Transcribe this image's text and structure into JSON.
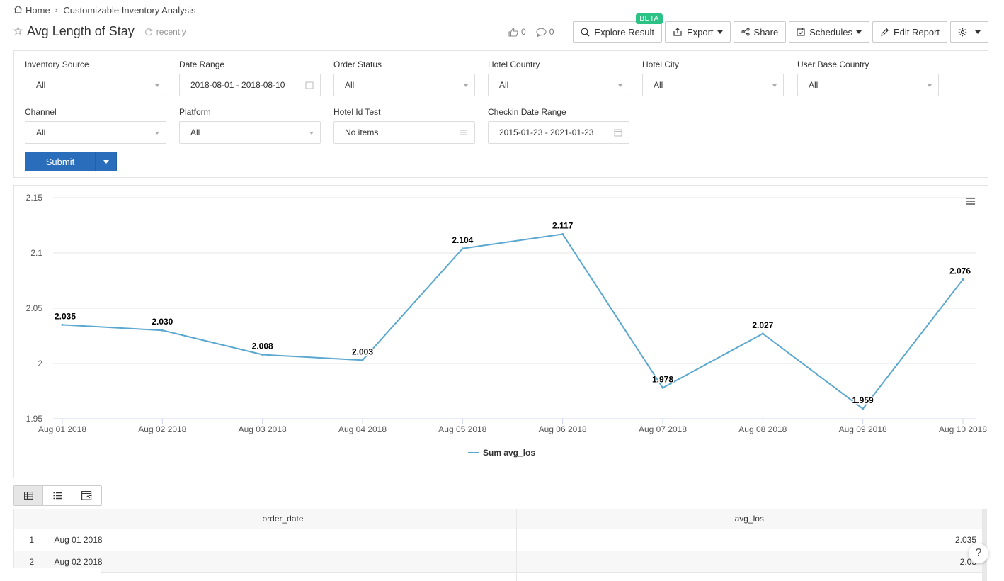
{
  "breadcrumb": {
    "home": "Home",
    "current": "Customizable Inventory Analysis"
  },
  "title": "Avg Length of Stay",
  "refresh_text": "recently",
  "likes": "0",
  "comments": "0",
  "actions": {
    "explore": "Explore Result",
    "beta": "BETA",
    "export": "Export",
    "share": "Share",
    "schedules": "Schedules",
    "edit": "Edit Report"
  },
  "filters": [
    {
      "label": "Inventory Source",
      "value": "All",
      "kind": "select"
    },
    {
      "label": "Date Range",
      "value": "2018-08-01 - 2018-08-10",
      "kind": "date"
    },
    {
      "label": "Order Status",
      "value": "All",
      "kind": "select"
    },
    {
      "label": "Hotel Country",
      "value": "All",
      "kind": "select"
    },
    {
      "label": "Hotel City",
      "value": "All",
      "kind": "select"
    },
    {
      "label": "User Base Country",
      "value": "All",
      "kind": "select"
    },
    {
      "label": "Channel",
      "value": "All",
      "kind": "select"
    },
    {
      "label": "Platform",
      "value": "All",
      "kind": "select"
    },
    {
      "label": "Hotel Id Test",
      "value": "No items",
      "kind": "list"
    },
    {
      "label": "Checkin Date Range",
      "value": "2015-01-23 - 2021-01-23",
      "kind": "date"
    }
  ],
  "submit_label": "Submit",
  "colors": {
    "line": "#5aa7cf",
    "primary": "#2a6ebb",
    "beta": "#2cc185"
  },
  "chart_data": {
    "type": "line",
    "categories": [
      "Aug 01 2018",
      "Aug 02 2018",
      "Aug 03 2018",
      "Aug 04 2018",
      "Aug 05 2018",
      "Aug 06 2018",
      "Aug 07 2018",
      "Aug 08 2018",
      "Aug 09 2018",
      "Aug 10 2018"
    ],
    "series": [
      {
        "name": "Sum avg_los",
        "values": [
          2.035,
          2.03,
          2.008,
          2.003,
          2.104,
          2.117,
          1.978,
          2.027,
          1.959,
          2.076
        ]
      }
    ],
    "data_labels": [
      "2.035",
      "2.030",
      "2.008",
      "2.003",
      "2.104",
      "2.117",
      "1.978",
      "2.027",
      "1.959",
      "2.076"
    ],
    "y_ticks": [
      "1.95",
      "2",
      "2.05",
      "2.1",
      "2.15"
    ],
    "ylim": [
      1.95,
      2.15
    ],
    "grid": true,
    "legend": "bottom-center"
  },
  "table": {
    "columns": [
      "order_date",
      "avg_los"
    ],
    "rows": [
      {
        "idx": "1",
        "date": "Aug 01 2018",
        "value": "2.035"
      },
      {
        "idx": "2",
        "date": "Aug 02 2018",
        "value": "2.03"
      }
    ]
  },
  "help": "?"
}
